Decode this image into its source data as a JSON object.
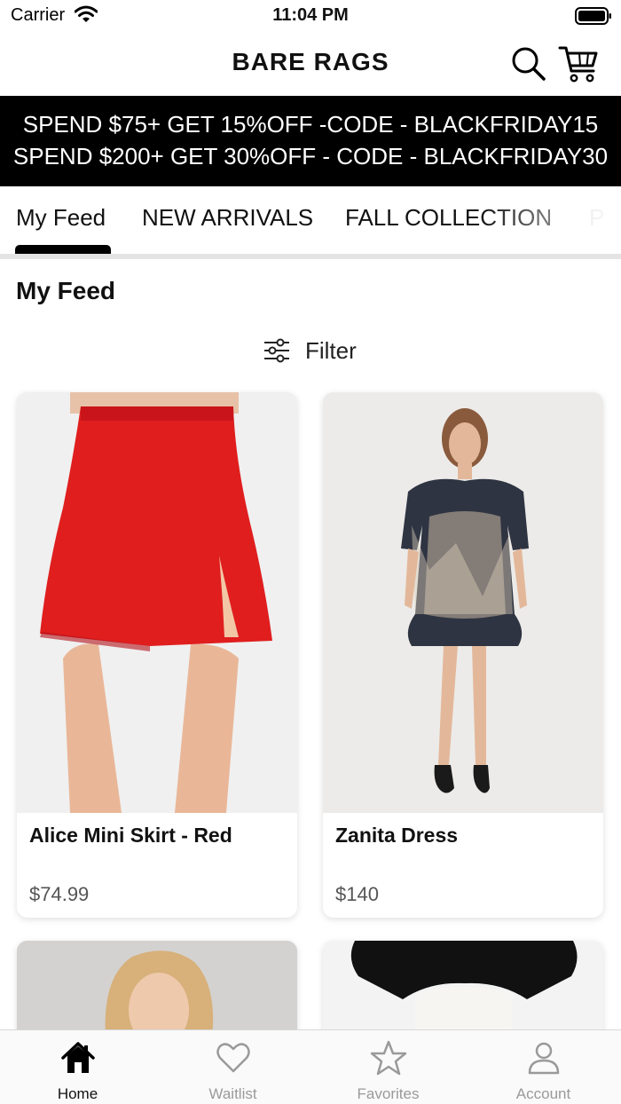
{
  "status_bar": {
    "carrier": "Carrier",
    "time": "11:04 PM"
  },
  "header": {
    "title": "BARE RAGS",
    "icons": [
      "search-icon",
      "cart-icon"
    ]
  },
  "promo": {
    "lines": [
      "SPEND $75+ GET 15%OFF -CODE - BLACKFRIDAY15",
      "SPEND $200+ GET 30%OFF - CODE - BLACKFRIDAY30"
    ]
  },
  "tabs": {
    "items": [
      {
        "label": "My Feed",
        "active": true
      },
      {
        "label": "NEW ARRIVALS",
        "active": false
      },
      {
        "label": "FALL COLLECTION",
        "active": false
      },
      {
        "label": "P",
        "active": false
      }
    ]
  },
  "feed": {
    "title": "My Feed",
    "filter_label": "Filter",
    "products": [
      {
        "name": "Alice Mini Skirt - Red",
        "price": "$74.99"
      },
      {
        "name": "Zanita Dress",
        "price": "$140"
      }
    ]
  },
  "tab_bar": {
    "items": [
      {
        "label": "Home",
        "icon": "home-icon",
        "active": true
      },
      {
        "label": "Waitlist",
        "icon": "heart-icon",
        "active": false
      },
      {
        "label": "Favorites",
        "icon": "star-icon",
        "active": false
      },
      {
        "label": "Account",
        "icon": "account-icon",
        "active": false
      }
    ]
  },
  "colors": {
    "banner_bg": "#000000",
    "accent": "#000000",
    "skirt_red": "#e01e1e",
    "inactive": "#9a9a9a"
  }
}
